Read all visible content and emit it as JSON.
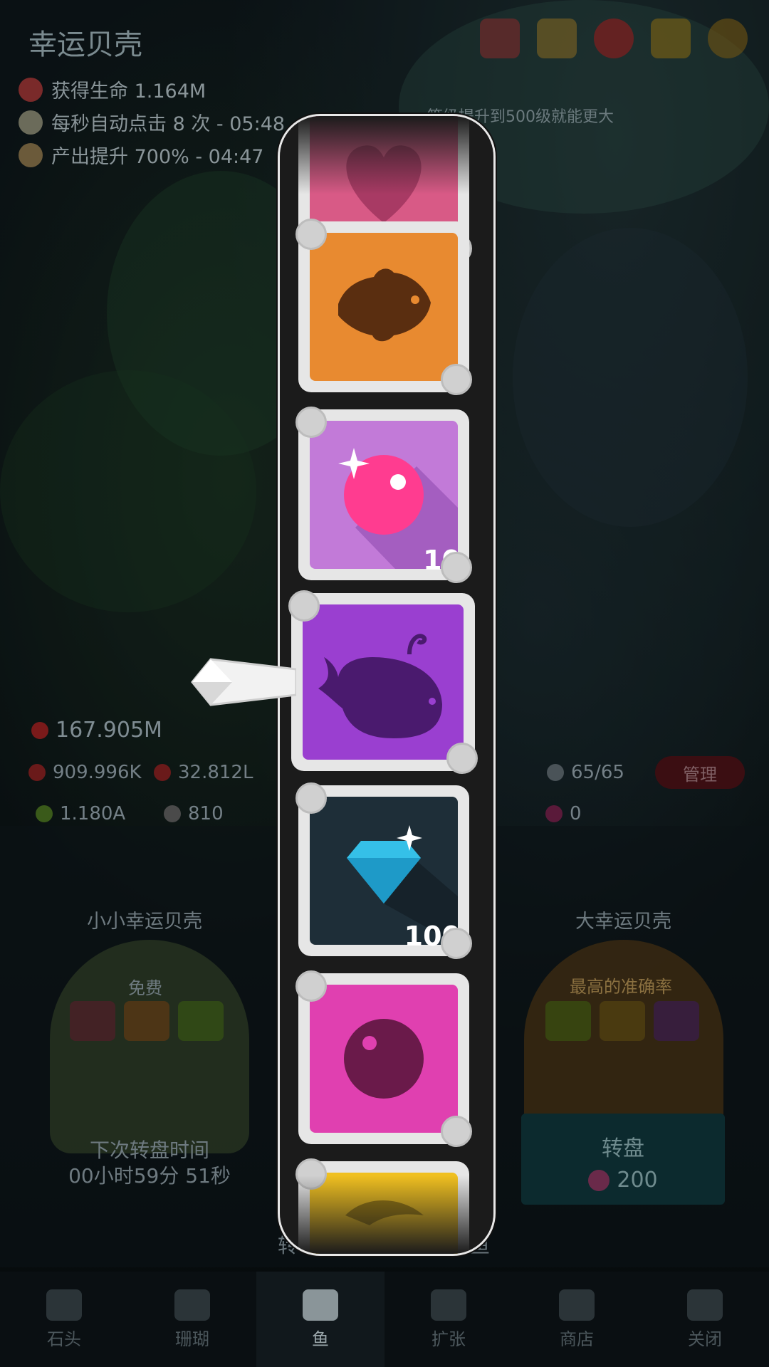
{
  "header": {
    "title": "幸运贝壳",
    "buffs": [
      {
        "text": "获得生命 1.164M",
        "icon": "heart-shell-icon"
      },
      {
        "text": "每秒自动点击 8 次 - 05:48",
        "icon": "auto-click-icon"
      },
      {
        "text": "产出提升 700% - 04:47",
        "icon": "boost-icon"
      }
    ],
    "banner": "等级提升到500级就能更大",
    "top_icons": [
      "photo-icon",
      "trophy-ribbon-icon",
      "alert-icon",
      "cup-icon",
      "settings-gear-icon"
    ]
  },
  "stats": {
    "life": "167.905M",
    "per_tap": "909.996K",
    "per_sec": "32.812L",
    "food": "1.180A",
    "fish_food": "810",
    "fish_count": "65/65",
    "pearls": "0",
    "manage_label": "管理"
  },
  "lucky_shell": {
    "small_title": "小小幸运贝壳",
    "small_free": "免费",
    "big_title": "大幸运贝壳",
    "big_subtitle": "最高的准确率",
    "next_spin_label": "下次转盘时间",
    "next_spin_time": "00小时59分 51秒",
    "spin_label": "转盘",
    "spin_cost": "200",
    "footer_left": "转",
    "footer_right": "鱼"
  },
  "reel": {
    "tiles": [
      {
        "name": "heart-tile",
        "color": "#d85a86",
        "icon": "heart-icon",
        "count": ""
      },
      {
        "name": "clownfish-tile",
        "color": "#e88a30",
        "icon": "clownfish-icon",
        "count": ""
      },
      {
        "name": "pearl-bonus-tile",
        "color": "#c27ad8",
        "icon": "pink-pearl-icon",
        "count": "10"
      },
      {
        "name": "whale-tile",
        "color": "#9a3fd0",
        "icon": "whale-icon",
        "count": ""
      },
      {
        "name": "diamond-tile",
        "color": "#1e2e38",
        "icon": "diamond-icon",
        "count": "100"
      },
      {
        "name": "magenta-pearl-tile",
        "color": "#e040b0",
        "icon": "pearl-icon",
        "count": ""
      },
      {
        "name": "dolphin-tile",
        "color": "#f0c020",
        "icon": "dolphin-icon",
        "count": ""
      }
    ],
    "selected_index": 3
  },
  "nav": {
    "items": [
      {
        "label": "石头",
        "icon": "rock-icon",
        "active": false
      },
      {
        "label": "珊瑚",
        "icon": "coral-icon",
        "active": false
      },
      {
        "label": "鱼",
        "icon": "fish-icon",
        "active": true
      },
      {
        "label": "扩张",
        "icon": "expand-icon",
        "active": false
      },
      {
        "label": "商店",
        "icon": "shop-cart-icon",
        "active": false
      },
      {
        "label": "关闭",
        "icon": "close-down-icon",
        "active": false
      }
    ]
  }
}
